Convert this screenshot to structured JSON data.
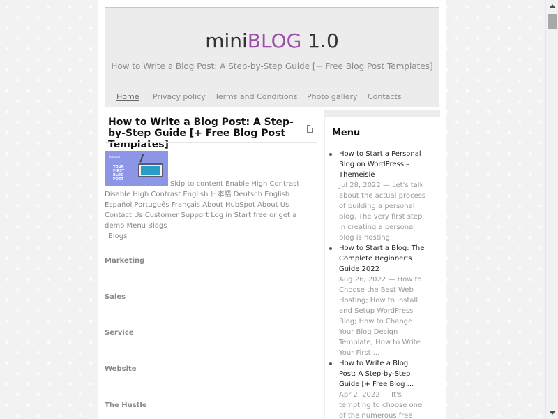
{
  "site": {
    "title_part1": "mini",
    "title_part2": "BLOG",
    "title_part3": " 1.0",
    "tagline": "How to Write a Blog Post: A Step-by-Step Guide [+ Free Blog Post Templates]",
    "accent_color": "#9b4fa8"
  },
  "nav": {
    "items": [
      {
        "label": "Home"
      },
      {
        "label": "Privacy policy"
      },
      {
        "label": "Terms and Conditions"
      },
      {
        "label": "Photo gallery"
      },
      {
        "label": "Contacts"
      }
    ]
  },
  "post": {
    "title": "How to Write a Blog Post: A Step-by-Step Guide [+ Free Blog Post Templates]",
    "thumb_text": "YOUR FIRST BLOG POST",
    "thumb_logo": "hubspot",
    "body": "Skip to content Enable High Contrast Disable High Contrast English 日本語 Deutsch English Español Português Français About HubSpot About Us Contact Us Customer Support Log in Start free or get a demo Menu Blogs",
    "blogs_label": "Blogs",
    "categories": [
      "Marketing",
      "Sales",
      "Service",
      "Website",
      "The Hustle"
    ]
  },
  "sidebar": {
    "title": "Menu",
    "items": [
      {
        "link": "How to Start a Personal Blog on WordPress – Themeisle",
        "excerpt": "Jul 28, 2022 — Let's talk about the actual process of building a personal blog. The very first step in creating a personal blog is hosting."
      },
      {
        "link": "How to Start a Blog: The Complete Beginner's Guide 2022",
        "excerpt": "Aug 26, 2022 — How to Choose the Best Web Hosting; How to Install and Setup WordPress Blog; How to Change Your Blog Design Template; How to Write Your First ..."
      },
      {
        "link": "How to Write a Blog Post: A Step-by-Step Guide [+ Free Blog ...",
        "excerpt": "Apr 2, 2022 — It's tempting to choose one of the numerous free"
      }
    ]
  }
}
